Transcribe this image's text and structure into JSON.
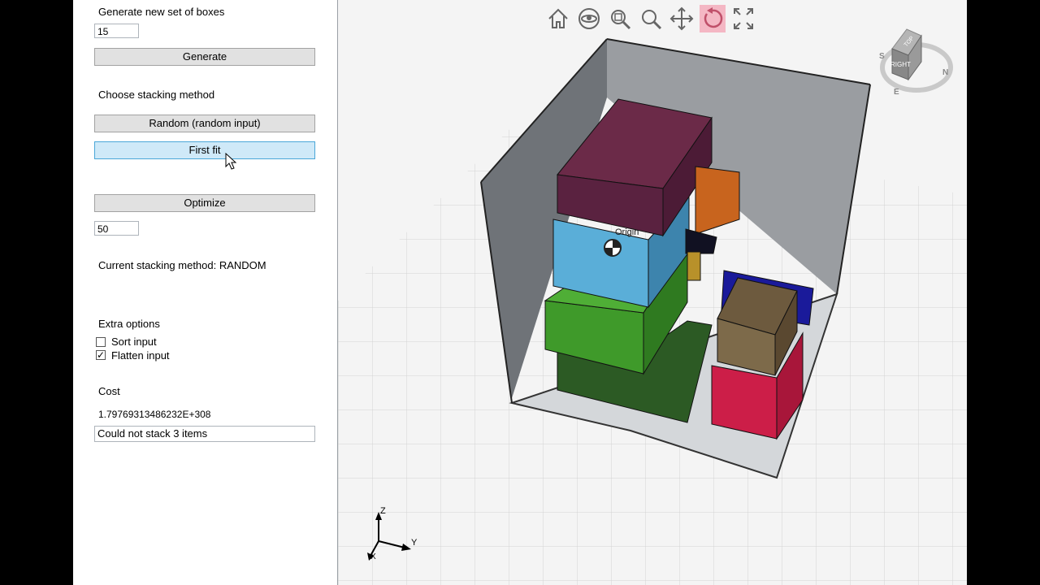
{
  "panel": {
    "generate_label": "Generate new set of boxes",
    "box_count": "15",
    "generate_button": "Generate",
    "stacking_label": "Choose stacking method",
    "random_button": "Random (random input)",
    "first_fit_button": "First fit",
    "optimize_button": "Optimize",
    "optimize_iterations": "50",
    "current_method": "Current stacking method: RANDOM",
    "extra_label": "Extra options",
    "sort_input_label": "Sort input",
    "sort_input_checked": false,
    "flatten_input_label": "Flatten input",
    "flatten_input_checked": true,
    "cost_label": "Cost",
    "cost_value": "1.79769313486232E+308",
    "status_message": "Could not stack 3 items"
  },
  "viewport": {
    "toolbar": [
      {
        "name": "home-icon",
        "active": false
      },
      {
        "name": "eye-icon",
        "active": false
      },
      {
        "name": "zoom-extents-icon",
        "active": false
      },
      {
        "name": "zoom-icon",
        "active": false
      },
      {
        "name": "pan-icon",
        "active": false
      },
      {
        "name": "rotate-icon",
        "active": true
      },
      {
        "name": "fullscreen-icon",
        "active": false
      }
    ],
    "origin_label": "Origin",
    "view_cube": {
      "top": "TOP",
      "right": "RIGHT",
      "compass_s": "S",
      "compass_e": "E",
      "compass_n": "N"
    },
    "axes": {
      "z": "Z",
      "y": "Y",
      "x": "X"
    }
  },
  "colors": {
    "accent_button": "#cfe9f8",
    "rotate_active": "#f4b7c4",
    "box_maroon": "#6b2a48",
    "box_blue": "#5aaed8",
    "box_green": "#3f9a2a",
    "box_darkgreen": "#2c5a24",
    "box_orange": "#c8641e",
    "box_navy": "#1a1a9a",
    "box_brown": "#6d5a3e",
    "box_red": "#cc1e48"
  }
}
